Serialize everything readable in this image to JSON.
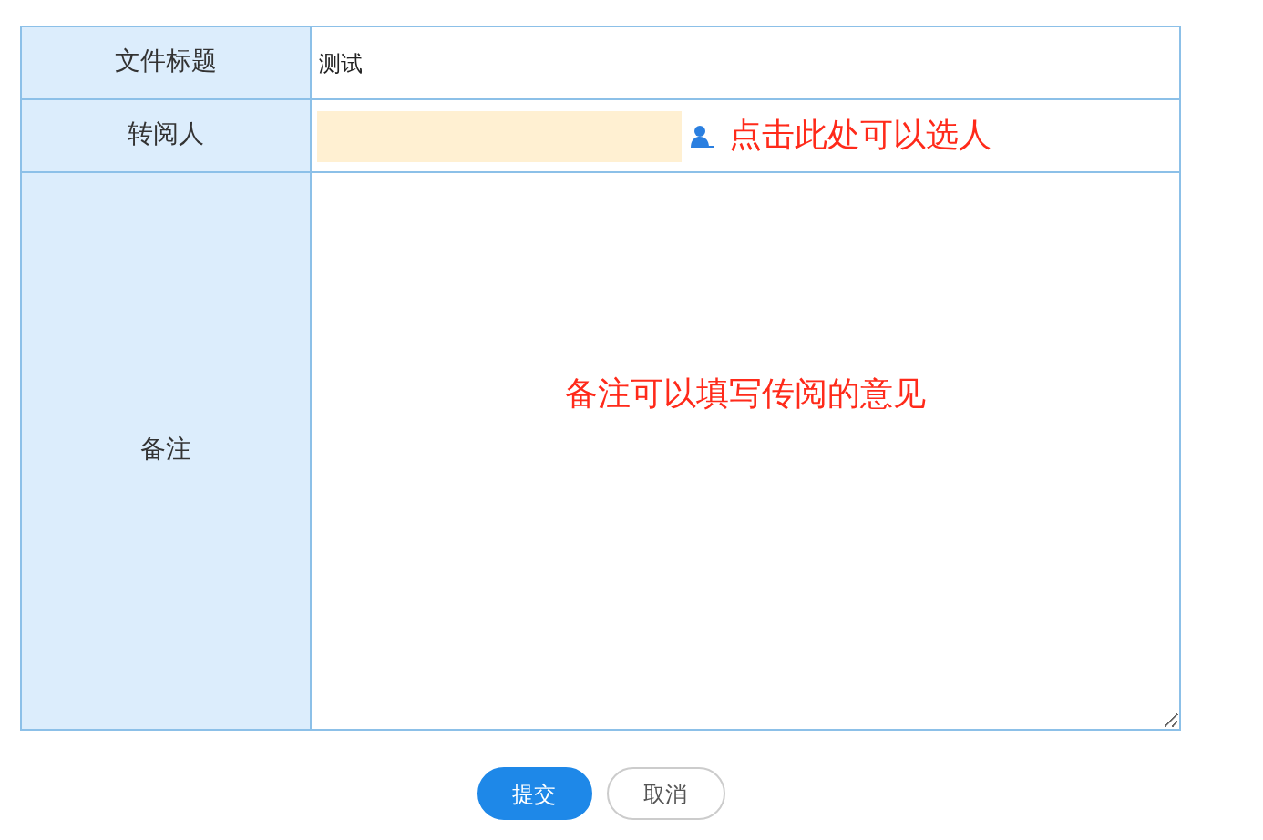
{
  "form": {
    "rows": [
      {
        "kind": "text",
        "label": "文件标题",
        "value": "测试"
      },
      {
        "kind": "picker",
        "label": "转阅人",
        "hint": "点击此处可以选人"
      },
      {
        "kind": "textarea",
        "label": "备注",
        "hint": "备注可以填写传阅的意见"
      }
    ]
  },
  "buttons": [
    {
      "label": "提交",
      "kind": "primary"
    },
    {
      "label": "取消",
      "kind": "secondary"
    }
  ]
}
